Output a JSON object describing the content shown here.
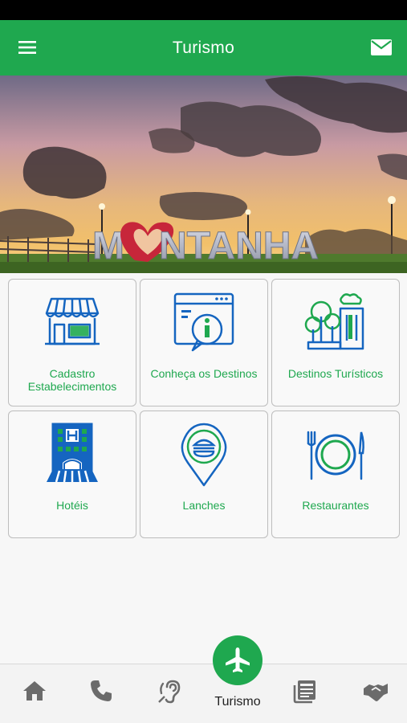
{
  "app_bar": {
    "title": "Turismo",
    "menu_icon": "hamburger-menu-icon",
    "mail_icon": "mail-icon"
  },
  "banner": {
    "sign_text": "MONTANHA",
    "heart_icon": "heart-icon"
  },
  "tiles": [
    {
      "label": "Cadastro Estabelecimentos",
      "icon": "storefront-icon"
    },
    {
      "label": "Conheça os Destinos",
      "icon": "info-browser-icon"
    },
    {
      "label": "Destinos Turísticos",
      "icon": "city-park-icon"
    },
    {
      "label": "Hotéis",
      "icon": "hotel-building-icon"
    },
    {
      "label": "Lanches",
      "icon": "burger-location-pin-icon"
    },
    {
      "label": "Restaurantes",
      "icon": "plate-cutlery-icon"
    }
  ],
  "bottom_nav": {
    "items": [
      {
        "icon": "home-icon"
      },
      {
        "icon": "phone-icon"
      },
      {
        "icon": "ear-hearing-icon"
      },
      {
        "icon": "airplane-icon",
        "label": "Turismo",
        "active": true
      },
      {
        "icon": "newspaper-icon"
      },
      {
        "icon": "handshake-icon"
      }
    ]
  },
  "colors": {
    "primary_green": "#1fa84f",
    "icon_blue": "#1565c0",
    "nav_icon_gray": "#6b6b6b"
  }
}
